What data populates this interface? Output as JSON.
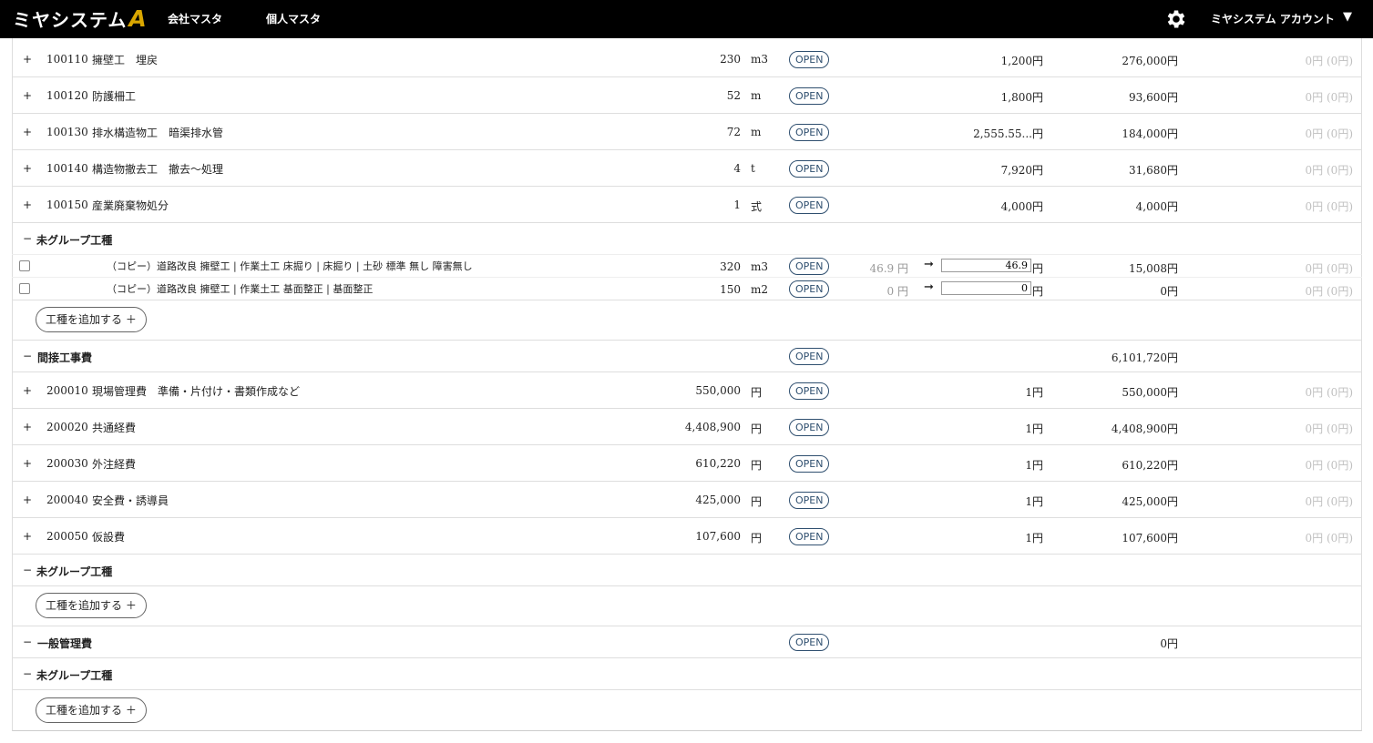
{
  "header": {
    "logo": "ミヤシステム",
    "logo_mark": "A",
    "nav": [
      "会社マスタ",
      "個人マスタ"
    ],
    "gear_icon": "gear-icon",
    "account": "ミヤシステム アカウント",
    "account_arrow": "▼"
  },
  "labels": {
    "open": "OPEN",
    "add_work": "工種を追加する ＋",
    "arrow": "➞",
    "yen": "円"
  },
  "items_a": [
    {
      "code": "100110",
      "name": "擁壁工　埋戻",
      "qty": "230",
      "unit": "m3",
      "price": "1,200円",
      "total": "276,000円",
      "sub": "0円 (0円)"
    },
    {
      "code": "100120",
      "name": "防護柵工",
      "qty": "52",
      "unit": "m",
      "price": "1,800円",
      "total": "93,600円",
      "sub": "0円 (0円)"
    },
    {
      "code": "100130",
      "name": "排水構造物工　暗渠排水管",
      "qty": "72",
      "unit": "m",
      "price": "2,555.55...円",
      "total": "184,000円",
      "sub": "0円 (0円)"
    },
    {
      "code": "100140",
      "name": "構造物撤去工　撤去〜処理",
      "qty": "4",
      "unit": "t",
      "price": "7,920円",
      "total": "31,680円",
      "sub": "0円 (0円)"
    },
    {
      "code": "100150",
      "name": "産業廃棄物処分",
      "qty": "1",
      "unit": "式",
      "price": "4,000円",
      "total": "4,000円",
      "sub": "0円 (0円)"
    }
  ],
  "ungrouped_title": "未グループ工種",
  "copies": [
    {
      "name": "（コピー）道路改良 擁壁工 | 作業土工 床掘り | 床掘り | 土砂 標準 無し 障害無し",
      "qty": "320",
      "unit": "m3",
      "old_price": "46.9 円",
      "new_price": "46.9",
      "total": "15,008円",
      "sub": "0円 (0円)"
    },
    {
      "name": "（コピー）道路改良 擁壁工 | 作業土工 基面整正 | 基面整正",
      "qty": "150",
      "unit": "m2",
      "old_price": "0 円",
      "new_price": "0",
      "total": "0円",
      "sub": "0円 (0円)"
    }
  ],
  "indirect": {
    "title": "間接工事費",
    "total": "6,101,720円"
  },
  "items_b": [
    {
      "code": "200010",
      "name": "現場管理費　準備・片付け・書類作成など",
      "qty": "550,000",
      "unit": "円",
      "price": "1円",
      "total": "550,000円",
      "sub": "0円 (0円)"
    },
    {
      "code": "200020",
      "name": "共通経費",
      "qty": "4,408,900",
      "unit": "円",
      "price": "1円",
      "total": "4,408,900円",
      "sub": "0円 (0円)"
    },
    {
      "code": "200030",
      "name": "外注経費",
      "qty": "610,220",
      "unit": "円",
      "price": "1円",
      "total": "610,220円",
      "sub": "0円 (0円)"
    },
    {
      "code": "200040",
      "name": "安全費・誘導員",
      "qty": "425,000",
      "unit": "円",
      "price": "1円",
      "total": "425,000円",
      "sub": "0円 (0円)"
    },
    {
      "code": "200050",
      "name": "仮設費",
      "qty": "107,600",
      "unit": "円",
      "price": "1円",
      "total": "107,600円",
      "sub": "0円 (0円)"
    }
  ],
  "general": {
    "title": "一般管理費",
    "total": "0円"
  }
}
